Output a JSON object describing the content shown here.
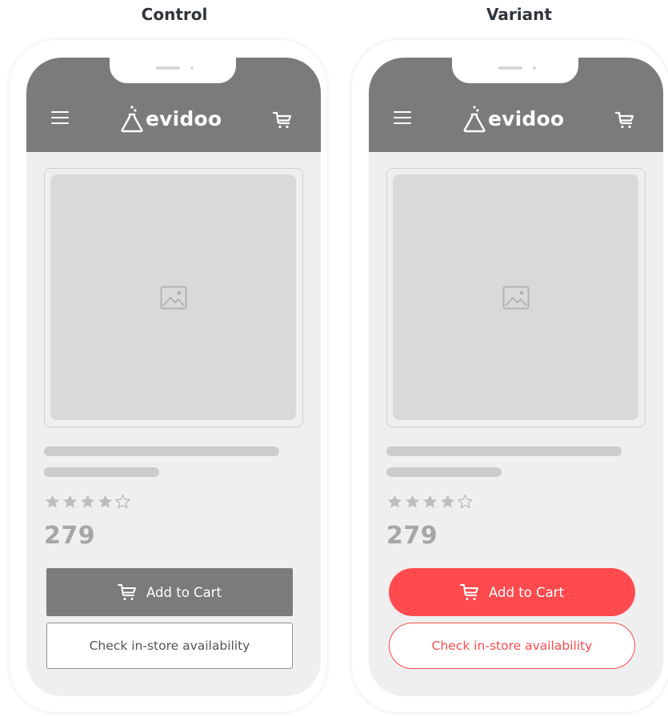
{
  "columns": {
    "control": {
      "title": "Control"
    },
    "variant": {
      "title": "Variant"
    }
  },
  "app": {
    "logo_text": "evidoo"
  },
  "product": {
    "price": "279",
    "rating": {
      "filled": 4,
      "total": 5
    }
  },
  "buttons": {
    "add_to_cart": "Add to Cart",
    "check_availability": "Check in-store availability"
  },
  "icons": {
    "menu": "hamburger-menu-icon",
    "cart": "cart-icon",
    "logo": "flask-icon",
    "image_placeholder": "image-placeholder-icon",
    "star": "star-icon"
  },
  "colors": {
    "header": "#7b7b7b",
    "control_button": "#7b7b7b",
    "variant_accent": "#ff4b4e",
    "screen_bg": "#efefef",
    "placeholder": "#d9d9d9"
  }
}
